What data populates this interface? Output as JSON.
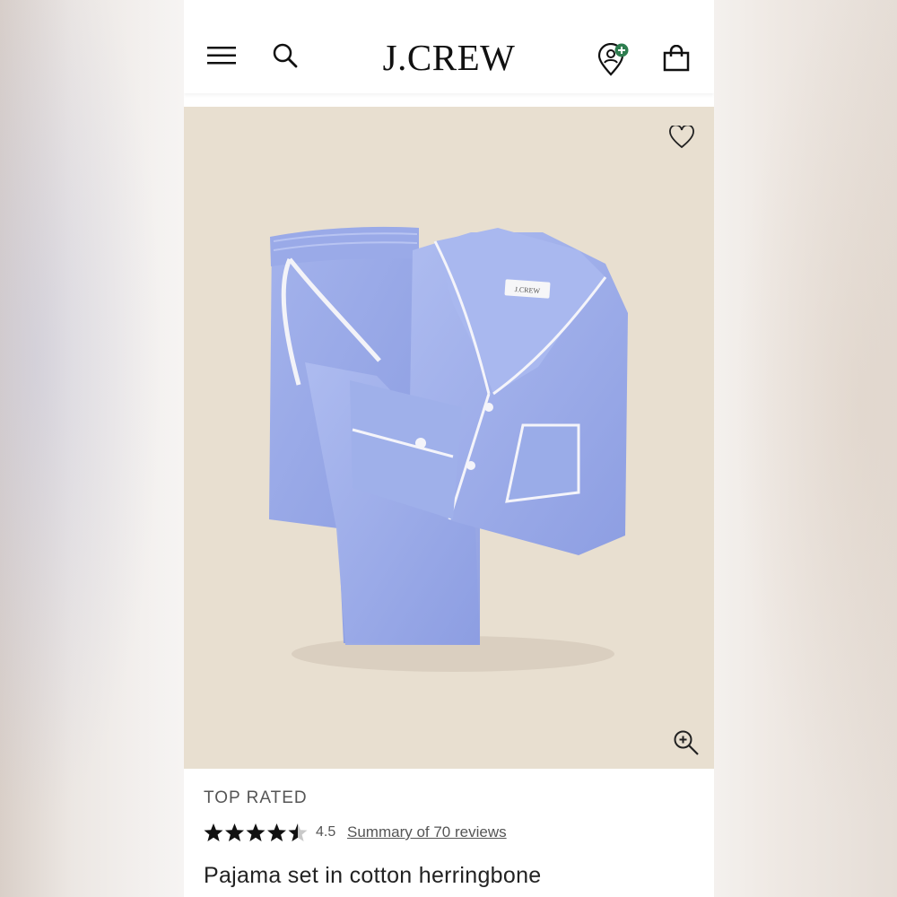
{
  "header": {
    "brand": "J.CREW",
    "menu_icon": "menu-icon",
    "search_icon": "search-icon",
    "store_icon": "store-locator-icon",
    "bag_icon": "shopping-bag-icon",
    "accent": "#2e7d4f"
  },
  "product": {
    "image_label": "J.CREW",
    "wishlist_icon": "heart-icon",
    "zoom_icon": "zoom-in-icon",
    "badge": "TOP RATED",
    "rating": "4.5",
    "rating_fraction": 0.9,
    "reviews_link": "Summary of 70 reviews",
    "title": "Pajama set in cotton herringbone",
    "image_bg": "#e8dfd0",
    "fabric_color": "#9fb0ea"
  }
}
